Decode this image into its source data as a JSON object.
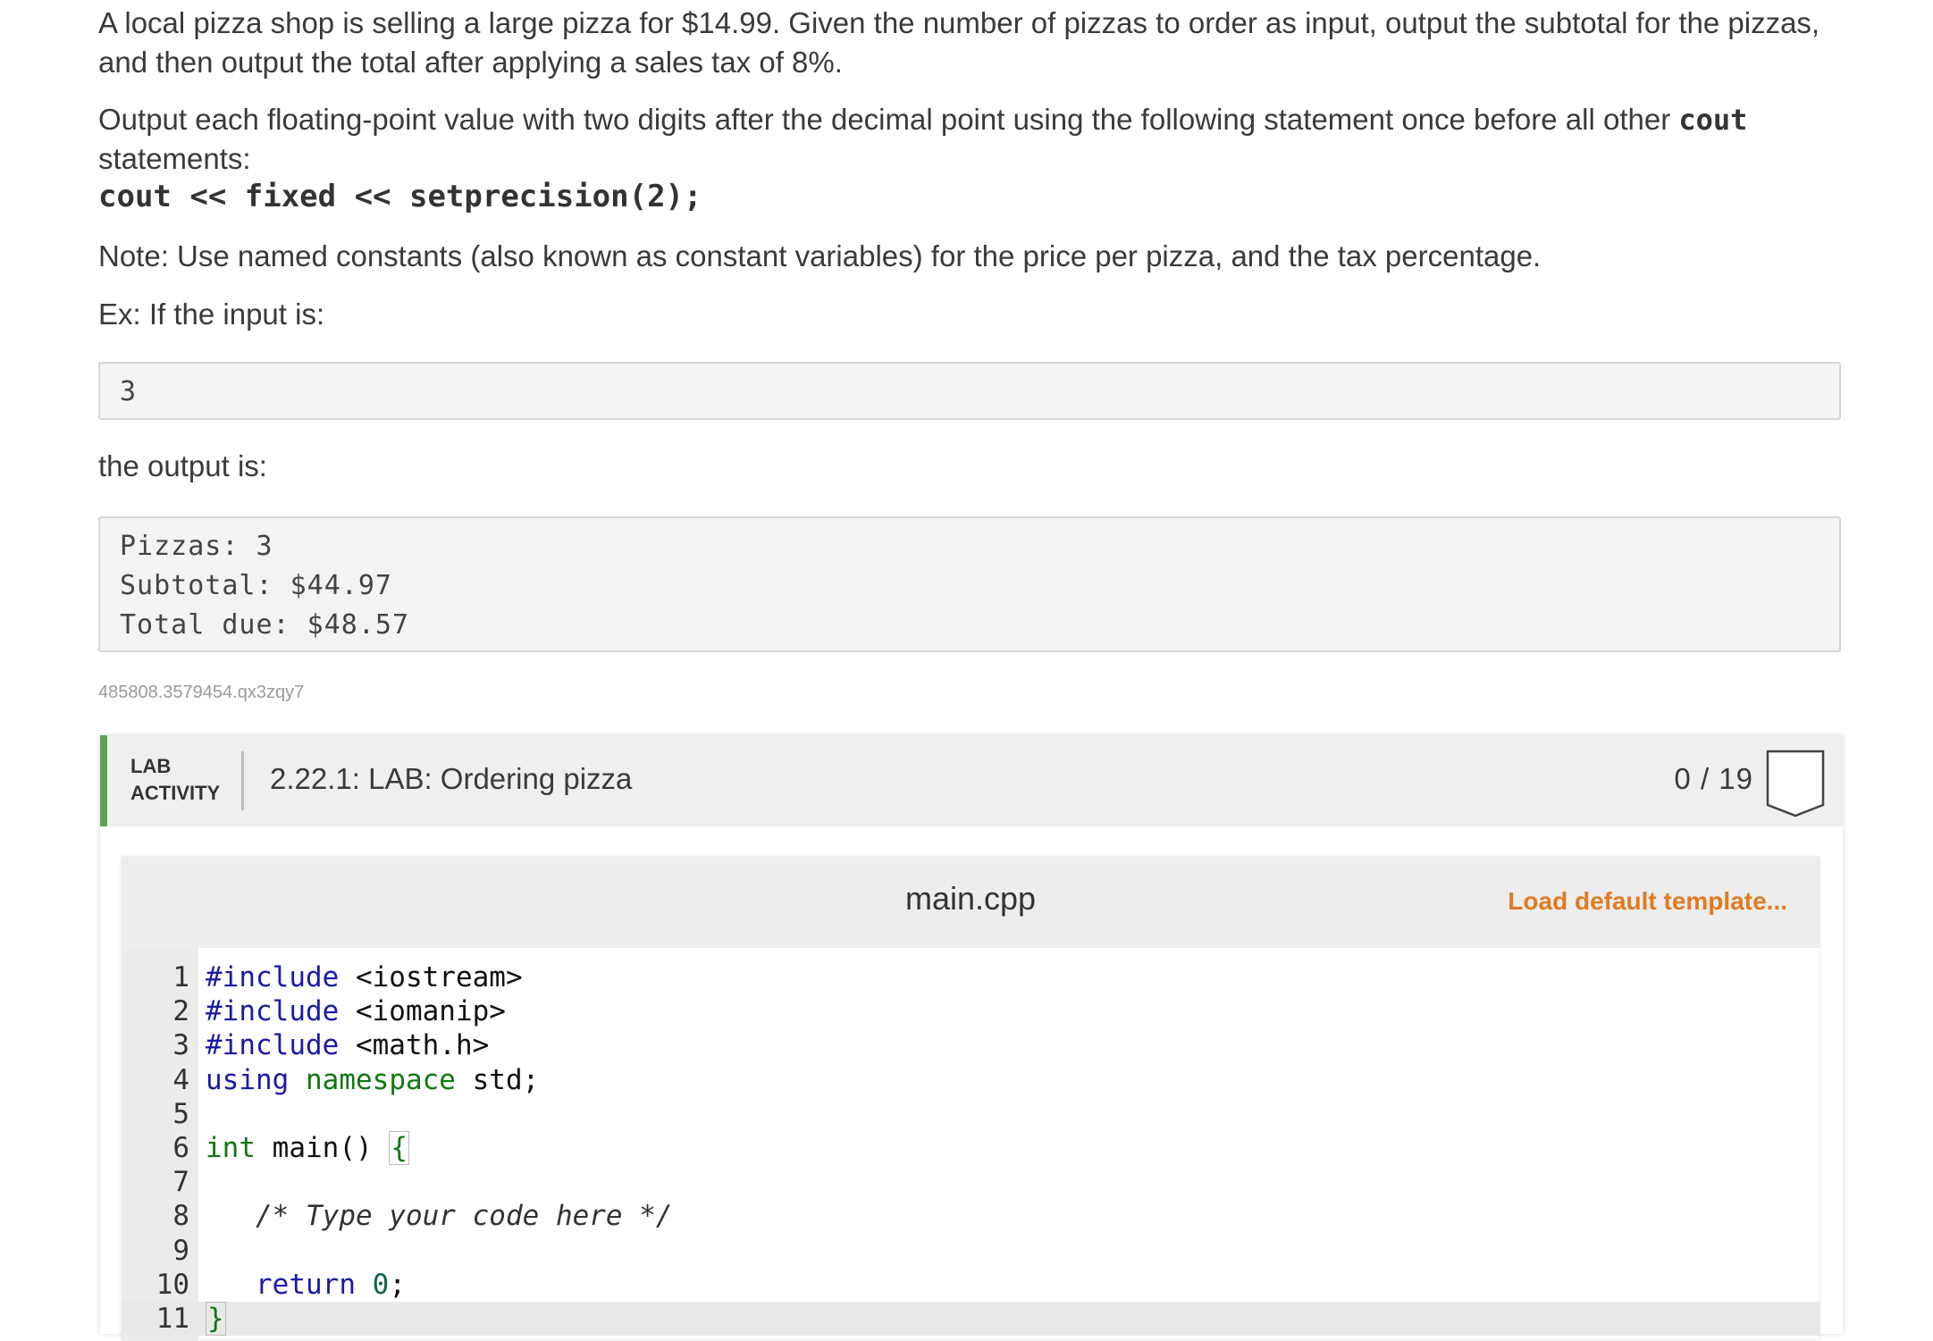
{
  "problem": {
    "paragraph1": "A local pizza shop is selling a large pizza for $14.99. Given the number of pizzas to order as input, output the subtotal for the pizzas, and then output the total after applying a sales tax of 8%.",
    "paragraph2_before": "Output each floating-point value with two digits after the decimal point using the following statement once before all other ",
    "paragraph2_code": "cout",
    "paragraph2_after": " statements:",
    "code_statement": "cout << fixed << setprecision(2);",
    "note": "Note: Use named constants (also known as constant variables) for the price per pizza, and the tax percentage.",
    "example_intro": "Ex: If the input is:",
    "example_input": "3",
    "output_intro": "the output is:",
    "example_output": [
      "Pizzas: 3",
      "Subtotal: $44.97",
      "Total due: $48.57"
    ],
    "meta_id": "485808.3579454.qx3zqy7"
  },
  "lab": {
    "tag_line1": "LAB",
    "tag_line2": "ACTIVITY",
    "title": "2.22.1: LAB: Ordering pizza",
    "score": "0 / 19",
    "accent_color": "#57a554"
  },
  "editor": {
    "file_name": "main.cpp",
    "load_template_label": "Load default template...",
    "load_color": "#e07b22",
    "lines": [
      {
        "num": "1",
        "parts": [
          [
            "kw",
            "#include"
          ],
          [
            "",
            " <iostream>"
          ]
        ]
      },
      {
        "num": "2",
        "parts": [
          [
            "kw",
            "#include"
          ],
          [
            "",
            " <iomanip>"
          ]
        ]
      },
      {
        "num": "3",
        "parts": [
          [
            "kw",
            "#include"
          ],
          [
            "",
            " <math.h>"
          ]
        ]
      },
      {
        "num": "4",
        "parts": [
          [
            "kw",
            "using"
          ],
          [
            "",
            " "
          ],
          [
            "ns",
            "namespace"
          ],
          [
            "",
            " std;"
          ]
        ]
      },
      {
        "num": "5",
        "parts": []
      },
      {
        "num": "6",
        "parts": [
          [
            "ty",
            "int"
          ],
          [
            "",
            " main() "
          ],
          [
            "brace",
            "{"
          ]
        ]
      },
      {
        "num": "7",
        "parts": []
      },
      {
        "num": "8",
        "parts": [
          [
            "",
            "   "
          ],
          [
            "cm",
            "/* Type your code here */"
          ]
        ]
      },
      {
        "num": "9",
        "parts": []
      },
      {
        "num": "10",
        "parts": [
          [
            "",
            "   "
          ],
          [
            "kw",
            "return"
          ],
          [
            "",
            " "
          ],
          [
            "nm",
            "0"
          ],
          [
            "",
            ";"
          ]
        ]
      },
      {
        "num": "11",
        "parts": [
          [
            "brace",
            "}"
          ]
        ],
        "active": true
      }
    ]
  }
}
